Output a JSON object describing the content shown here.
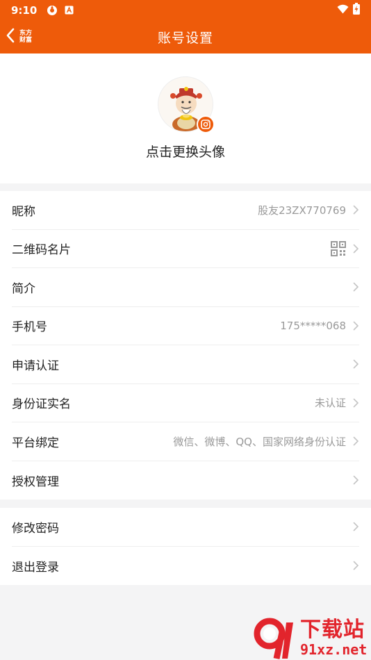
{
  "status_bar": {
    "time": "9:10",
    "icons": [
      "loop-app-icon",
      "a-app-icon"
    ],
    "right_icons": [
      "wifi-icon",
      "battery-charging-icon"
    ]
  },
  "header": {
    "back_icon": "chevron-left-icon",
    "brand_line1": "东方",
    "brand_line2": "财富",
    "title": "账号设置",
    "background": "#ee5b0a"
  },
  "avatar": {
    "label": "点击更换头像",
    "badge_icon": "camera-icon"
  },
  "settings_group1": [
    {
      "label": "昵称",
      "value": "股友23ZX770769"
    },
    {
      "label": "二维码名片",
      "value": ""
    },
    {
      "label": "简介",
      "value": ""
    },
    {
      "label": "手机号",
      "value": "175*****068"
    },
    {
      "label": "申请认证",
      "value": ""
    },
    {
      "label": "身份证实名",
      "value": "未认证"
    },
    {
      "label": "平台绑定",
      "value": "微信、微博、QQ、国家网络身份认证"
    },
    {
      "label": "授权管理",
      "value": ""
    }
  ],
  "settings_group2": [
    {
      "label": "修改密码"
    },
    {
      "label": "退出登录"
    }
  ],
  "watermark": {
    "brand": "下载站",
    "url": "91xz.net"
  },
  "colors": {
    "accent": "#ee5b0a",
    "value_text": "#999999",
    "watermark_red": "#e2242c"
  }
}
